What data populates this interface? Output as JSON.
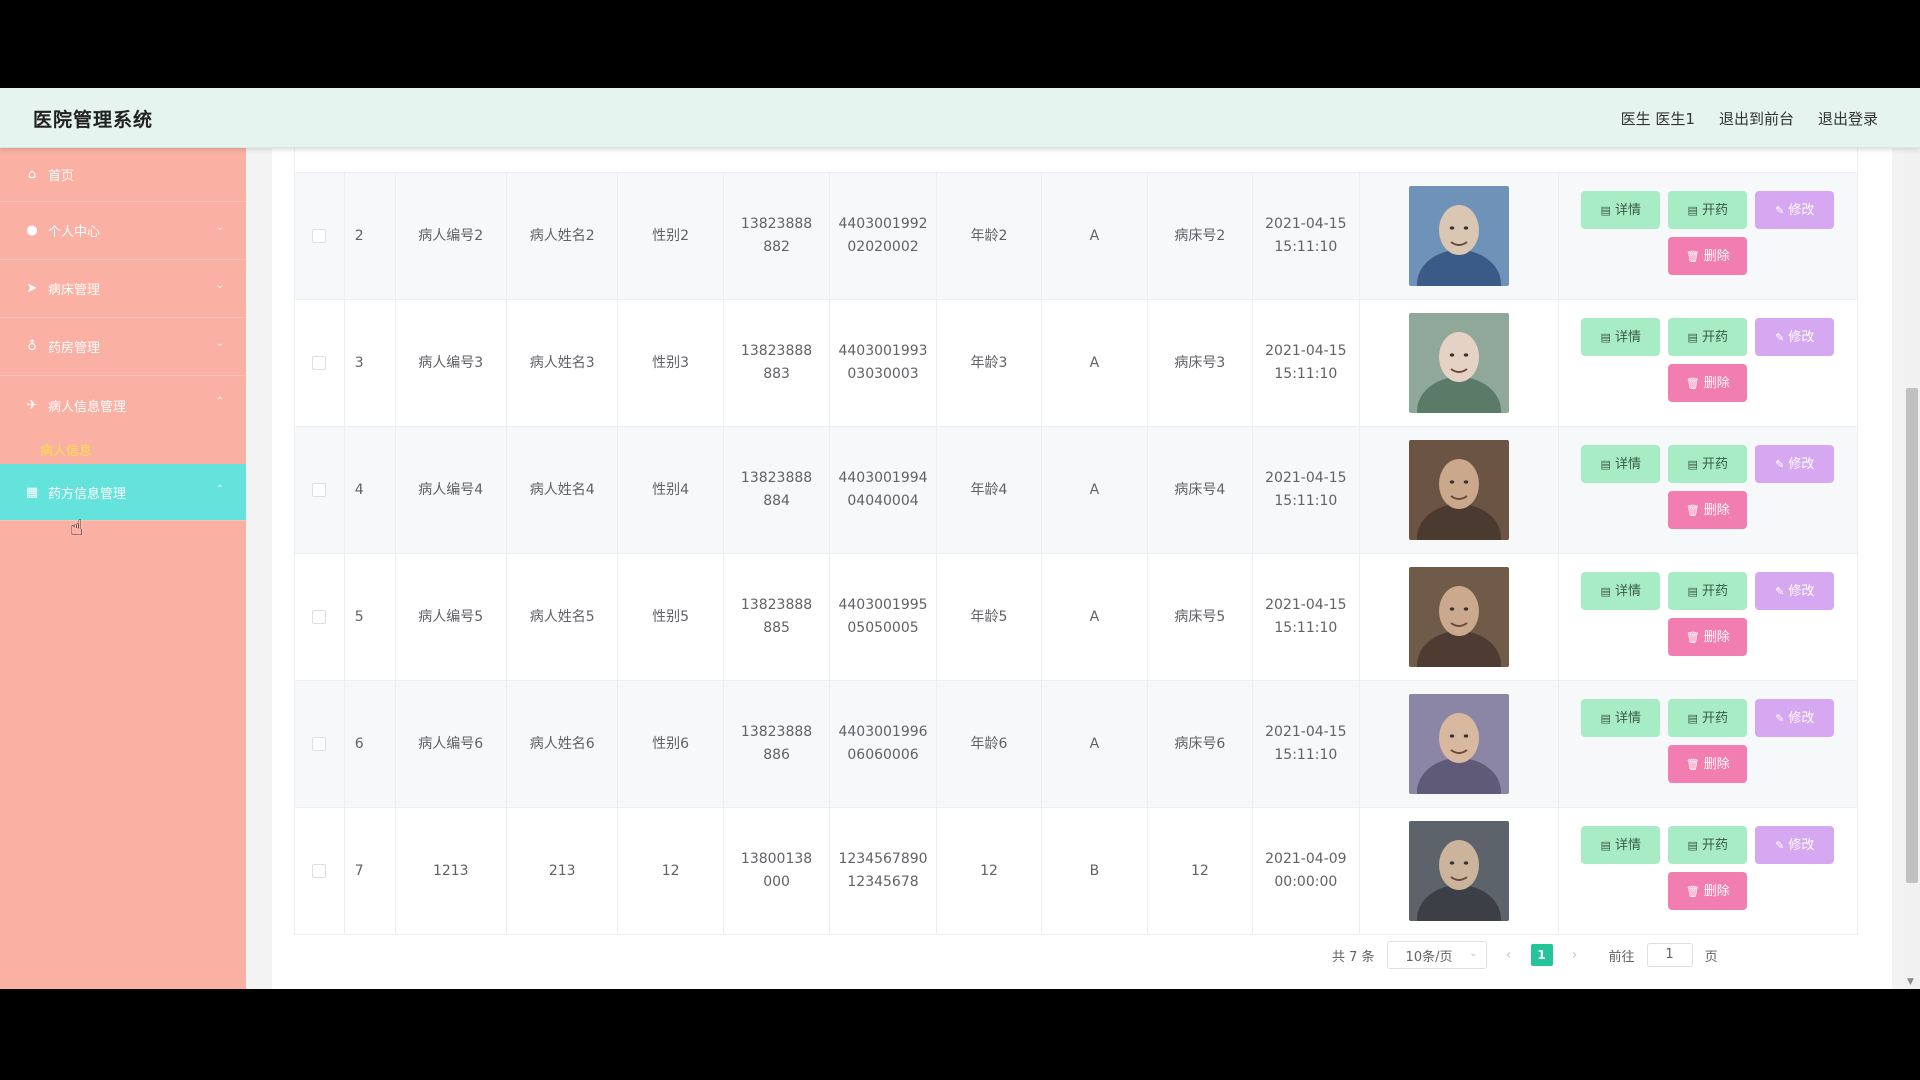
{
  "app": {
    "title": "医院管理系统"
  },
  "header": {
    "user": "医生 医生1",
    "front": "退出到前台",
    "logout": "退出登录"
  },
  "sidebar": {
    "items": [
      {
        "label": "首页",
        "icon": "home-icon"
      },
      {
        "label": "个人中心",
        "icon": "user-icon"
      },
      {
        "label": "病床管理",
        "icon": "send-icon"
      },
      {
        "label": "药房管理",
        "icon": "mic-icon"
      },
      {
        "label": "病人信息管理",
        "icon": "plane-icon"
      },
      {
        "label": "药方信息管理",
        "icon": "grid-icon"
      }
    ],
    "sub_item": "病人信息"
  },
  "buttons": {
    "detail": "详情",
    "rx": "开药",
    "edit": "修改",
    "delete": "删除"
  },
  "rows": [
    {
      "idx": "2",
      "code": "病人编号2",
      "name": "病人姓名2",
      "gender": "性别2",
      "phone": "13823888882",
      "idcard": "440300199202020002",
      "age": "年龄2",
      "blood": "A",
      "bed": "病床号2",
      "date": "2021-04-15",
      "time": "15:11:10"
    },
    {
      "idx": "3",
      "code": "病人编号3",
      "name": "病人姓名3",
      "gender": "性别3",
      "phone": "13823888883",
      "idcard": "440300199303030003",
      "age": "年龄3",
      "blood": "A",
      "bed": "病床号3",
      "date": "2021-04-15",
      "time": "15:11:10"
    },
    {
      "idx": "4",
      "code": "病人编号4",
      "name": "病人姓名4",
      "gender": "性别4",
      "phone": "13823888884",
      "idcard": "440300199404040004",
      "age": "年龄4",
      "blood": "A",
      "bed": "病床号4",
      "date": "2021-04-15",
      "time": "15:11:10"
    },
    {
      "idx": "5",
      "code": "病人编号5",
      "name": "病人姓名5",
      "gender": "性别5",
      "phone": "13823888885",
      "idcard": "440300199505050005",
      "age": "年龄5",
      "blood": "A",
      "bed": "病床号5",
      "date": "2021-04-15",
      "time": "15:11:10"
    },
    {
      "idx": "6",
      "code": "病人编号6",
      "name": "病人姓名6",
      "gender": "性别6",
      "phone": "13823888886",
      "idcard": "440300199606060006",
      "age": "年龄6",
      "blood": "A",
      "bed": "病床号6",
      "date": "2021-04-15",
      "time": "15:11:10"
    },
    {
      "idx": "7",
      "code": "1213",
      "name": "213",
      "gender": "12",
      "phone": "13800138000",
      "idcard": "123456789012345678",
      "age": "12",
      "blood": "B",
      "bed": "12",
      "date": "2021-04-09",
      "time": "00:00:00"
    }
  ],
  "pager": {
    "total": "共 7 条",
    "size": "10条/页",
    "current": "1",
    "goto": "前往",
    "page_value": "1",
    "page_unit": "页"
  }
}
